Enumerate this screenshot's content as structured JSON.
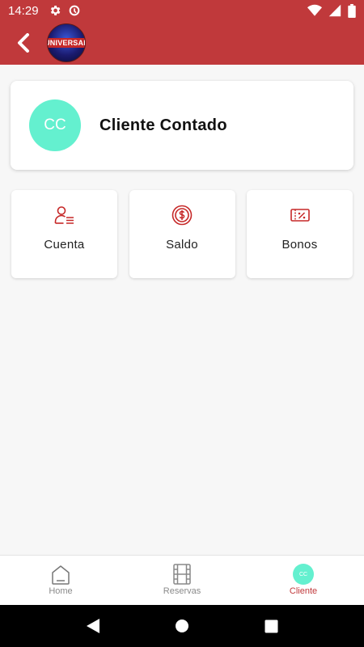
{
  "status_bar": {
    "time": "14:29",
    "icons": [
      "gear-icon",
      "data-saver-icon",
      "wifi-icon",
      "signal-icon",
      "battery-icon"
    ]
  },
  "app_bar": {
    "logo_text": "UNIVERSAL",
    "accent_color": "#c0393b"
  },
  "profile": {
    "initials": "CC",
    "name": "Cliente Contado",
    "avatar_color": "#64f0cf"
  },
  "tiles": [
    {
      "label": "Cuenta",
      "icon": "user-list-icon"
    },
    {
      "label": "Saldo",
      "icon": "dollar-coin-icon"
    },
    {
      "label": "Bonos",
      "icon": "discount-ticket-icon"
    }
  ],
  "bottom_nav": {
    "items": [
      {
        "label": "Home",
        "icon": "home-icon",
        "active": false
      },
      {
        "label": "Reservas",
        "icon": "film-icon",
        "active": false
      },
      {
        "label": "Cliente",
        "icon": "avatar",
        "active": true,
        "initials": "CC"
      }
    ]
  },
  "system_nav": [
    "back-triangle-icon",
    "home-circle-icon",
    "recents-square-icon"
  ]
}
